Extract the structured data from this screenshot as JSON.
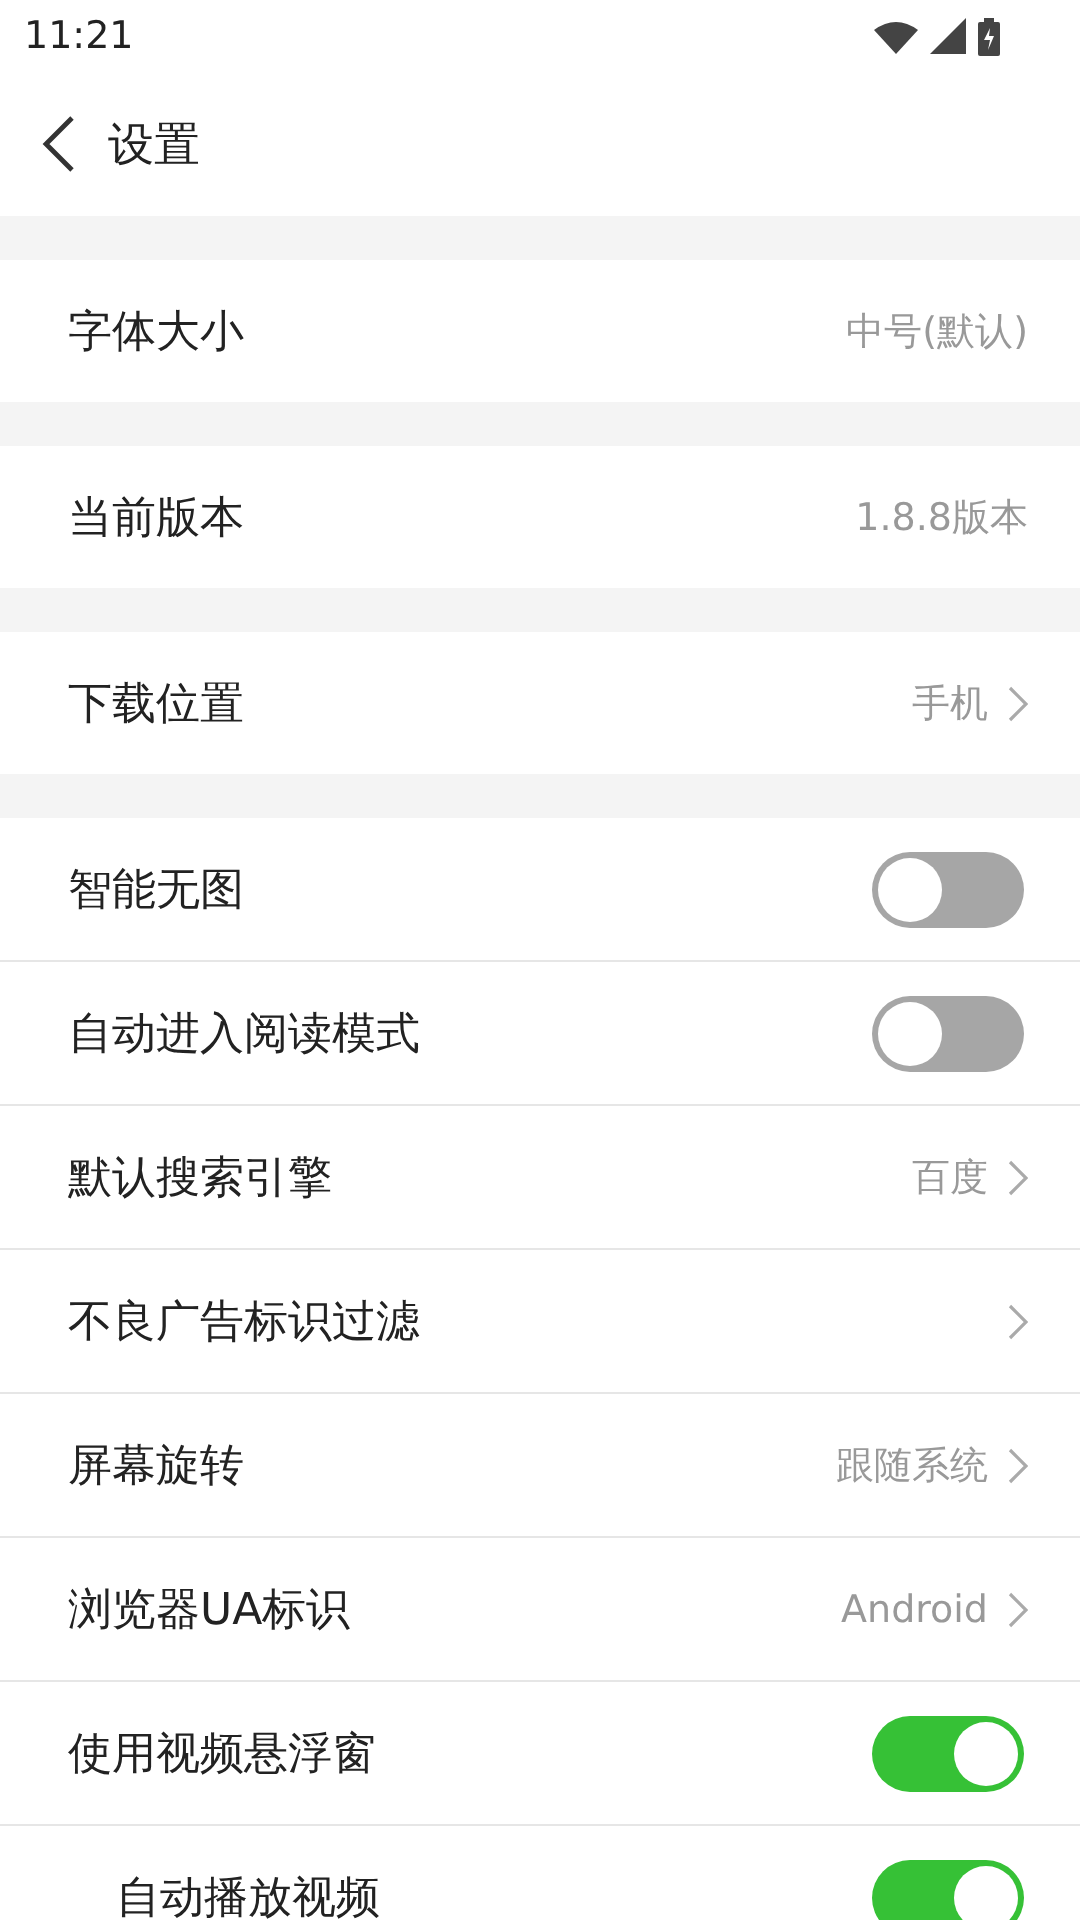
{
  "status_bar": {
    "time": "11:21"
  },
  "header": {
    "title": "设置"
  },
  "sections": [
    {
      "items": [
        {
          "kind": "value",
          "label": "字体大小",
          "value": "中号(默认)"
        }
      ]
    },
    {
      "items": [
        {
          "kind": "value",
          "label": "当前版本",
          "value": "1.8.8版本"
        }
      ]
    },
    {
      "items": [
        {
          "kind": "link",
          "label": "下载位置",
          "value": "手机"
        }
      ]
    },
    {
      "items": [
        {
          "kind": "toggle",
          "label": "智能无图",
          "on": false
        },
        {
          "kind": "toggle",
          "label": "自动进入阅读模式",
          "on": false
        },
        {
          "kind": "link",
          "label": "默认搜索引擎",
          "value": "百度"
        },
        {
          "kind": "link",
          "label": "不良广告标识过滤"
        },
        {
          "kind": "link",
          "label": "屏幕旋转",
          "value": "跟随系统"
        },
        {
          "kind": "link",
          "label": "浏览器UA标识",
          "value": "Android"
        },
        {
          "kind": "toggle",
          "label": "使用视频悬浮窗",
          "on": true,
          "children": [
            {
              "kind": "toggle",
              "label": "自动播放视频",
              "on": true
            }
          ]
        }
      ]
    }
  ]
}
